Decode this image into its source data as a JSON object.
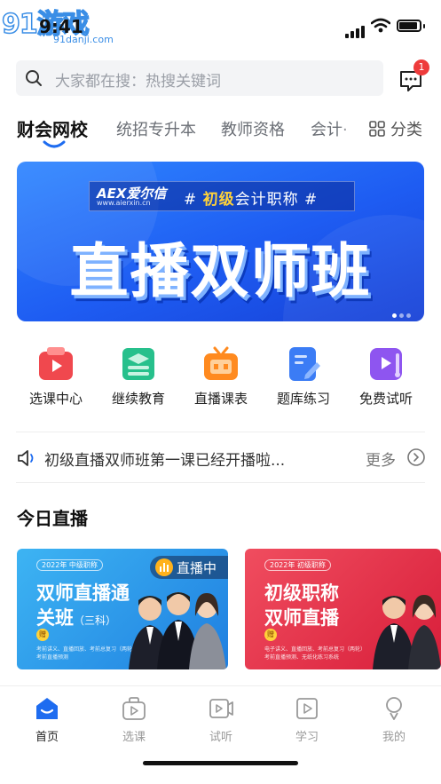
{
  "status_bar": {
    "time": "9:41",
    "watermark": "91游戏",
    "watermark_site": "91danji.com"
  },
  "search": {
    "placeholder": "大家都在搜：热搜关键词",
    "message_badge": "1"
  },
  "tabs": [
    {
      "label": "财会网校",
      "active": true
    },
    {
      "label": "统招专升本",
      "active": false
    },
    {
      "label": "教师资格",
      "active": false
    },
    {
      "label": "会计·",
      "active": false
    }
  ],
  "category_label": "分类",
  "banner": {
    "brand": "AEX爱尔信",
    "url": "www.aierxin.cn",
    "tag_prefix": "# ",
    "tag_highlight": "初级",
    "tag_rest": "会计职称 #",
    "title": "直播双师班",
    "page_count": 3,
    "current_page": 1
  },
  "quick_entries": [
    {
      "label": "选课中心",
      "icon": "course-select-icon",
      "color": "#f0484e"
    },
    {
      "label": "继续教育",
      "icon": "continuing-education-icon",
      "color": "#27c08c"
    },
    {
      "label": "直播课表",
      "icon": "live-schedule-icon",
      "color": "#ff8a1f"
    },
    {
      "label": "题库练习",
      "icon": "question-bank-icon",
      "color": "#3b7cf5"
    },
    {
      "label": "免费试听",
      "icon": "free-trial-icon",
      "color": "#8e55f0"
    }
  ],
  "notice": {
    "text": "初级直播双师班第一课已经开播啦...",
    "more": "更多"
  },
  "today_live": {
    "title": "今日直播",
    "cards": [
      {
        "year_tag": "2022年 中级职称",
        "title_line1": "双师直播通",
        "title_line2": "关班",
        "title_suffix": "（三科）",
        "gift": "赠",
        "note": "考前讲义、直播回放、考前总复习（两轮）",
        "note2": "考前直播预测",
        "live_label": "直播中"
      },
      {
        "year_tag": "2022年 初级职称",
        "title_line1": "初级职称",
        "title_line2": "双师直播",
        "gift": "赠",
        "note": "电子讲义、直播回放、考前总复习（两轮）",
        "note2": "考前直播预测、无纸化练习系统"
      }
    ]
  },
  "tab_bar": [
    {
      "label": "首页",
      "active": true
    },
    {
      "label": "选课",
      "active": false
    },
    {
      "label": "试听",
      "active": false
    },
    {
      "label": "学习",
      "active": false
    },
    {
      "label": "我的",
      "active": false
    }
  ],
  "colors": {
    "accent": "#1e6cf0",
    "primary_text": "#222222",
    "muted_text": "#999999"
  }
}
